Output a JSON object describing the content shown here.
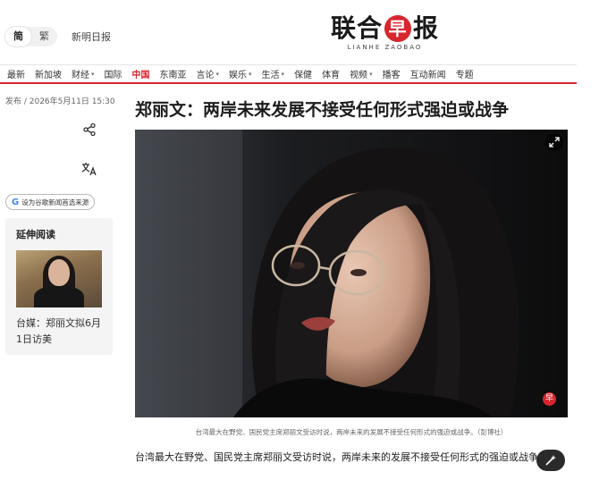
{
  "header": {
    "lang_simplified": "简",
    "lang_traditional": "繁",
    "sister_link": "新明日报",
    "logo_cn_1": "联合",
    "logo_cn_red": "早",
    "logo_cn_2": "报",
    "logo_en": "LIANHE ZAOBAO"
  },
  "nav": {
    "items": [
      "最新",
      "新加坡",
      "财经",
      "国际",
      "中国",
      "东南亚",
      "言论",
      "娱乐",
      "生活",
      "保健",
      "体育",
      "视频",
      "播客",
      "互动新闻",
      "专题"
    ],
    "active": "中国",
    "caret_glyph": "▾"
  },
  "meta": {
    "published": "发布 / 2026年5月11日 15:30"
  },
  "sidebar": {
    "google_label": "设为谷歌新闻首选来源",
    "related_title": "延伸阅读",
    "related_text": "台媒：郑丽文拟6月1日访美"
  },
  "article": {
    "headline": "郑丽文：两岸未来发展不接受任何形式强迫或战争",
    "caption": "台湾最大在野党、国民党主席郑丽文受访时说，两岸未来的发展不接受任何形式的强迫或战争。（彭博社）",
    "photo_badge": "早",
    "body": "台湾最大在野党、国民党主席郑丽文受访时说，两岸未来的发展不接受任何形式的强迫或战争。"
  },
  "icons": {
    "share": "share-icon",
    "translate": "translate-icon",
    "expand": "expand-icon",
    "ai_summary": "ai-summary-icon"
  },
  "colors": {
    "brand_red": "#d7262e",
    "text": "#222222"
  }
}
